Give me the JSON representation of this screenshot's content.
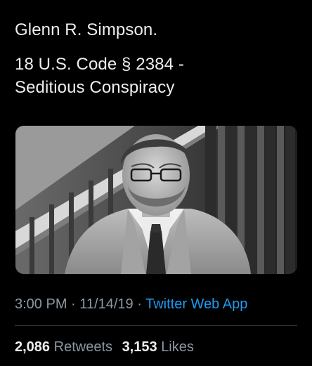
{
  "tweet": {
    "lines": [
      "Glenn R. Simpson.",
      "18 U.S. Code § 2384 -",
      "Seditious Conspiracy"
    ],
    "media": {
      "icon": "photo-of-man-in-suit"
    },
    "time": "3:00 PM",
    "date": "11/14/19",
    "separator": "·",
    "source": "Twitter Web App",
    "retweets": {
      "count": "2,086",
      "label": "Retweets"
    },
    "likes": {
      "count": "3,153",
      "label": "Likes"
    },
    "colors": {
      "background": "#000000",
      "text": "#eeeeee",
      "muted": "#8b98a5",
      "link": "#1d9bf0"
    }
  }
}
